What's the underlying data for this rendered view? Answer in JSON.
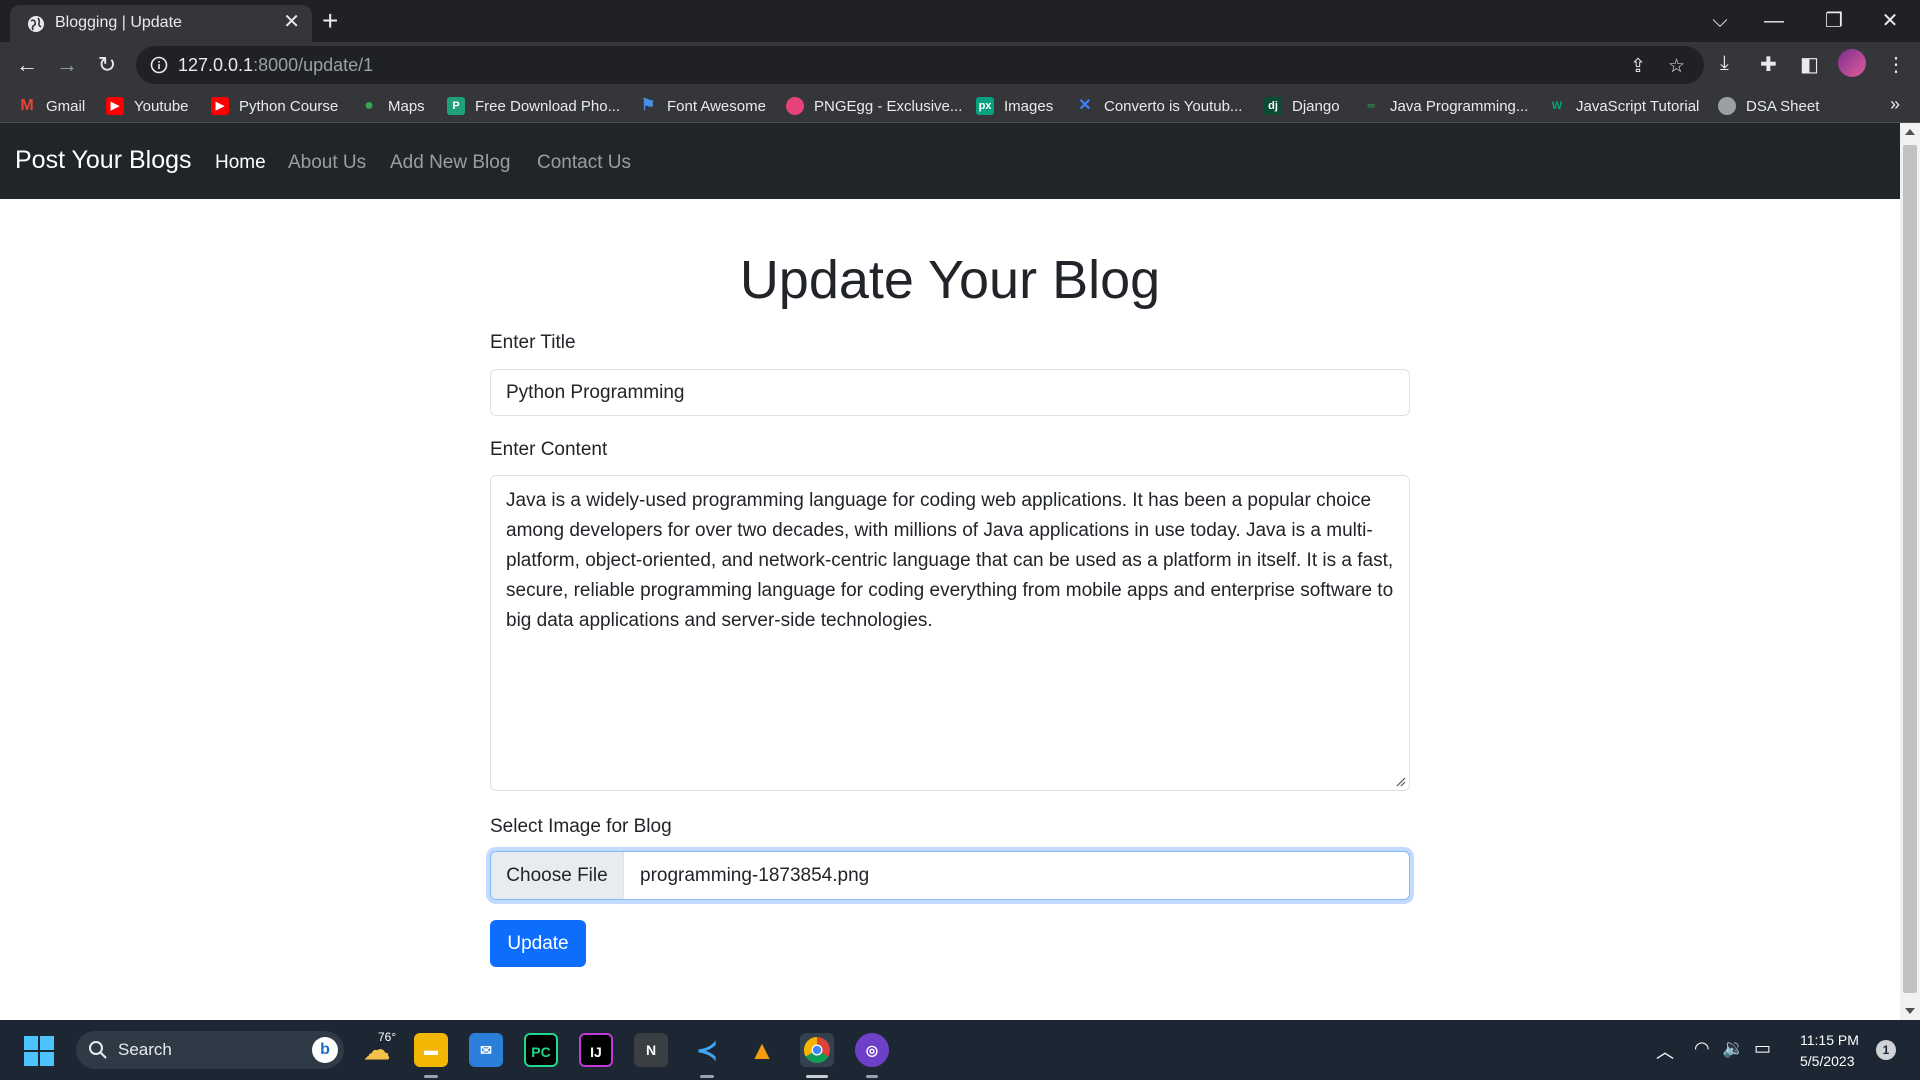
{
  "browser": {
    "tab_title": "Blogging | Update",
    "url_host": "127.0.0.1",
    "url_path": ":8000/update/1",
    "bookmarks": [
      {
        "label": "Gmail",
        "icon": "gmail-icon",
        "color": "#ea4335"
      },
      {
        "label": "Youtube",
        "icon": "youtube-icon",
        "color": "#ff0000"
      },
      {
        "label": "Python Course",
        "icon": "youtube-icon",
        "color": "#ff0000"
      },
      {
        "label": "Maps",
        "icon": "maps-icon",
        "color": "#34a853"
      },
      {
        "label": "Free Download Pho...",
        "icon": "photo-icon",
        "color": "#1fa27a"
      },
      {
        "label": "Font Awesome",
        "icon": "flag-icon",
        "color": "#4a8fe7"
      },
      {
        "label": "PNGEgg - Exclusive...",
        "icon": "egg-icon",
        "color": "#e8427a"
      },
      {
        "label": "Images",
        "icon": "pexels-icon",
        "color": "#07a081"
      },
      {
        "label": "Converto is Youtub...",
        "icon": "converto-icon",
        "color": "#3b82f6"
      },
      {
        "label": "Django",
        "icon": "django-icon",
        "color": "#0c4b33"
      },
      {
        "label": "Java Programming...",
        "icon": "geeks-icon",
        "color": "#2f8d46"
      },
      {
        "label": "JavaScript Tutorial",
        "icon": "w3-icon",
        "color": "#04aa6d"
      },
      {
        "label": "DSA Sheet",
        "icon": "globe-icon",
        "color": "#9aa0a6"
      }
    ]
  },
  "site": {
    "brand": "Post Your Blogs",
    "nav": [
      "Home",
      "About Us",
      "Add New Blog",
      "Contact Us"
    ]
  },
  "form": {
    "heading": "Update Your Blog",
    "title_label": "Enter Title",
    "title_value": "Python Programming",
    "content_label": "Enter Content",
    "content_value": "Java is a widely-used programming language for coding web applications. It has been a popular choice among developers for over two decades, with millions of Java applications in use today. Java is a multi-platform, object-oriented, and network-centric language that can be used as a platform in itself. It is a fast, secure, reliable programming language for coding everything from mobile apps and enterprise software to big data applications and server-side technologies.",
    "image_label": "Select Image for Blog",
    "choose_file_label": "Choose File",
    "file_name": "programming-1873854.png",
    "submit_label": "Update"
  },
  "taskbar": {
    "search_label": "Search",
    "weather_temp": "76°",
    "time": "11:15 PM",
    "date": "5/5/2023",
    "notification_count": "1"
  },
  "colors": {
    "navbar_bg": "#212529",
    "primary": "#0d6efd",
    "chrome_bg": "#35363a"
  }
}
